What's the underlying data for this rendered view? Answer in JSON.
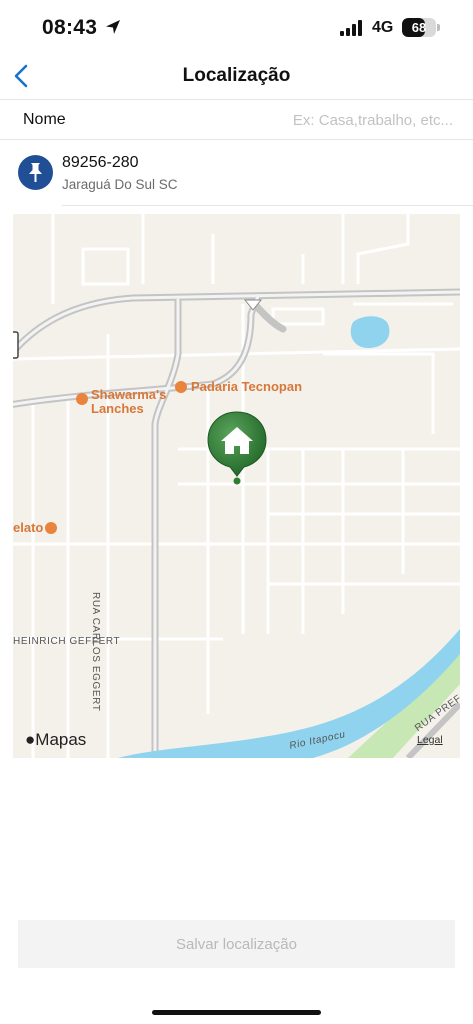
{
  "status_bar": {
    "time": "08:43",
    "network": "4G",
    "battery": "68",
    "battery_level": 0.68
  },
  "navbar": {
    "title": "Localização",
    "back_icon": "chevron-left-icon"
  },
  "name_field": {
    "label": "Nome",
    "placeholder": "Ex: Casa,trabalho, etc...",
    "value": ""
  },
  "address": {
    "icon": "pushpin-icon",
    "postal_code": "89256-280",
    "city": "Jaraguá Do Sul SC"
  },
  "map": {
    "pois": [
      {
        "label": "Padaria Tecnopan"
      },
      {
        "label": "Shawarma's Lanches"
      },
      {
        "label": "elato"
      }
    ],
    "streets": [
      {
        "label": "RUA CARLOS EGGERT"
      },
      {
        "label": "HEINRICH GEFFERT"
      },
      {
        "label": "Rio Itapocu"
      },
      {
        "label": "RUA PREF"
      }
    ],
    "attribution": "Mapas",
    "legal": "Legal",
    "marker_icon": "home-icon"
  },
  "actions": {
    "save_label": "Salvar localização"
  },
  "colors": {
    "accent": "#1a73c8",
    "pin_badge": "#214f95",
    "marker": "#2f7d32",
    "poi": "#e8843e",
    "water": "#8fd3ef"
  }
}
